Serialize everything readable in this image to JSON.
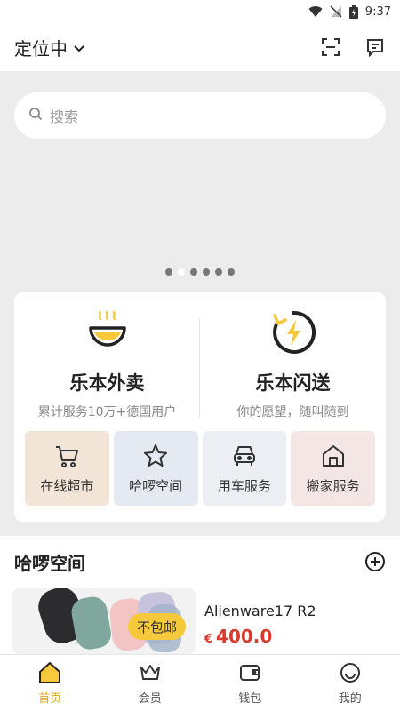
{
  "status_bar": {
    "time": "9:37"
  },
  "header": {
    "location": "定位中"
  },
  "search": {
    "placeholder": "搜索"
  },
  "banner": {
    "page_count": 6,
    "active_index": 1
  },
  "services": {
    "main": [
      {
        "title": "乐本外卖",
        "subtitle": "累计服务10万+德国用户"
      },
      {
        "title": "乐本闪送",
        "subtitle": "你的愿望，随叫随到"
      }
    ],
    "tiles": [
      {
        "label": "在线超市",
        "icon": "shopping-cart-icon",
        "bg": "#f2e4d6"
      },
      {
        "label": "哈啰空间",
        "icon": "star-icon",
        "bg": "#e4e9f2"
      },
      {
        "label": "用车服务",
        "icon": "car-icon",
        "bg": "#eceef4"
      },
      {
        "label": "搬家服务",
        "icon": "house-icon",
        "bg": "#f4e6e4"
      }
    ]
  },
  "section": {
    "title": "哈啰空间"
  },
  "product": {
    "name": "Alienware17 R2",
    "currency": "€",
    "price": "400.0",
    "badge": "不包邮"
  },
  "tab_bar": {
    "items": [
      {
        "label": "首页",
        "icon": "home-icon",
        "active": true
      },
      {
        "label": "会员",
        "icon": "crown-icon",
        "active": false
      },
      {
        "label": "钱包",
        "icon": "wallet-icon",
        "active": false
      },
      {
        "label": "我的",
        "icon": "smile-icon",
        "active": false
      }
    ]
  },
  "colors": {
    "accent": "#f5c93b",
    "price": "#d63b2f",
    "tab_active": "#e4a815"
  }
}
